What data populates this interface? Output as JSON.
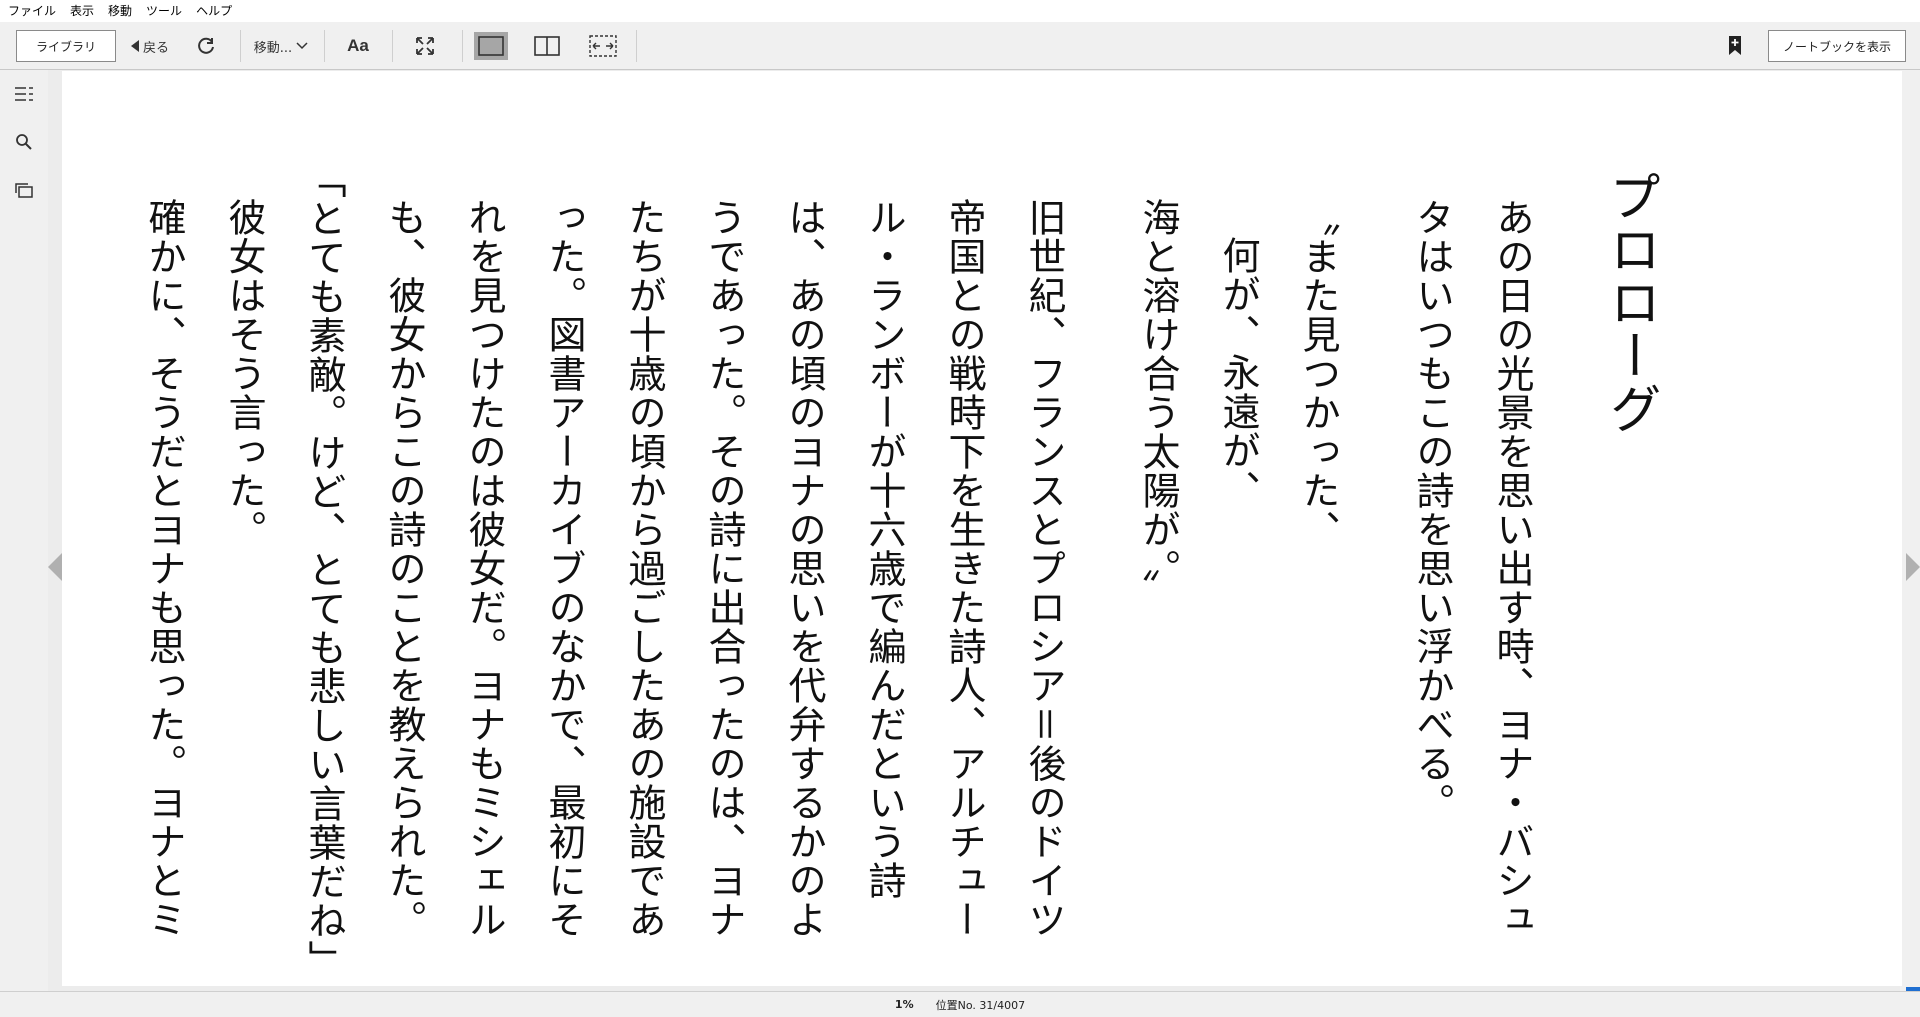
{
  "menu": [
    "ファイル",
    "表示",
    "移動",
    "ツール",
    "ヘルプ"
  ],
  "toolbar": {
    "library_label": "ライブラリ",
    "back_label": "戻る",
    "goto_label": "移動...",
    "font_label": "Aa",
    "notebook_label": "ノートブックを表示"
  },
  "book": {
    "title": "プロローグ",
    "paragraphs": [
      "あの日の光景を思い出す時、ヨナ・バシュタはいつもこの詩を思い浮かべる。",
      "〝また見つかった、",
      "何が、永遠が、",
      "海と溶け合う太陽が。〞",
      "旧世紀、フランスとプロシア＝後のドイツ帝国との戦時下を生きた詩人、アルチュール・ランボーが十六歳で編んだという詩は、あの頃のヨナの思いを代弁するかのようであった。その詩に出合ったのは、ヨナたちが十歳の頃から過ごしたあの施設であった。図書アーカイブのなかで、最初にそれを見つけたのは彼女だ。ヨナもミシェルも、彼女からこの詩のことを教えられた。",
      "「とても素敵。けど、とても悲しい言葉だね」",
      "彼女はそう言った。",
      "確かに、そうだとヨナも思った。ヨナとミ"
    ]
  },
  "status": {
    "percent": "1%",
    "location": "位置No. 31/4007"
  },
  "progress": 0.01
}
